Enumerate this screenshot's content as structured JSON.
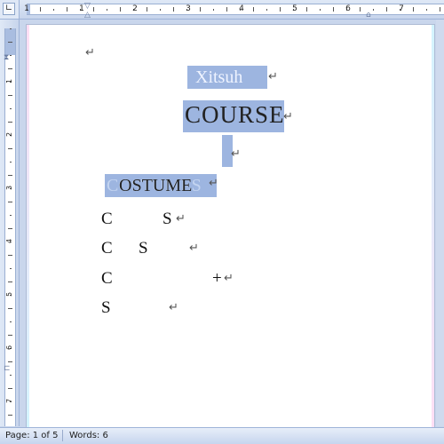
{
  "document": {
    "blank_mark": "↵",
    "title_line": {
      "text": "Xitsuh",
      "mark": "↵"
    },
    "heading_line": {
      "text": "COURSE",
      "mark": "↵"
    },
    "empty_line": {
      "mark": "↵"
    },
    "sub_heading_line": {
      "text": "OSTUME",
      "ghost": "COSTUMES",
      "mark": "↵"
    },
    "lines": [
      {
        "left": "C",
        "right": "S",
        "mark": "↵"
      },
      {
        "left": "C",
        "right": "S",
        "mark": "↵"
      },
      {
        "left": "C",
        "right": "+",
        "mark": "↵"
      },
      {
        "left": "S",
        "right": "",
        "mark": "↵"
      }
    ]
  },
  "ruler": {
    "horizontal_numbers": [
      "1",
      "1",
      "2",
      "3",
      "4",
      "5",
      "6",
      "7"
    ],
    "vertical_numbers": [
      "1",
      "2",
      "3",
      "4",
      "5",
      "6",
      "7"
    ]
  },
  "statusbar": {
    "page": "Page: 1 of 5",
    "words": "Words: 6"
  },
  "colors": {
    "highlight": "#9db5e0",
    "ruler_bg": "#dfe8f6",
    "workspace": "#c9d6ec"
  }
}
